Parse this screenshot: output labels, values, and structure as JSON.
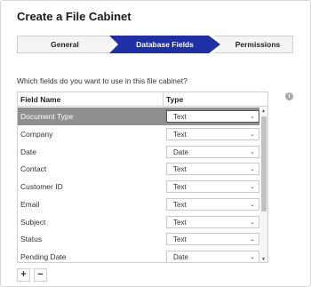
{
  "dialog": {
    "title": "Create a File Cabinet"
  },
  "wizard": {
    "steps": [
      {
        "label": "General",
        "active": false
      },
      {
        "label": "Database Fields",
        "active": true
      },
      {
        "label": "Permissions",
        "active": false
      }
    ],
    "active_color": "#1f2fa6"
  },
  "question": "Which fields do you want to use in this file cabinet?",
  "grid": {
    "columns": [
      "Field Name",
      "Type"
    ],
    "rows": [
      {
        "name": "Document Type",
        "type": "Text",
        "selected": true
      },
      {
        "name": "Company",
        "type": "Text"
      },
      {
        "name": "Date",
        "type": "Date"
      },
      {
        "name": "Contact",
        "type": "Text"
      },
      {
        "name": "Customer ID",
        "type": "Text"
      },
      {
        "name": "Email",
        "type": "Text"
      },
      {
        "name": "Subject",
        "type": "Text"
      },
      {
        "name": "Status",
        "type": "Text"
      },
      {
        "name": "Pending Date",
        "type": "Date"
      }
    ]
  },
  "actions": {
    "add": "+",
    "remove": "−"
  },
  "icons": {
    "info": "info-icon",
    "chevron": "chevron-down-icon"
  }
}
